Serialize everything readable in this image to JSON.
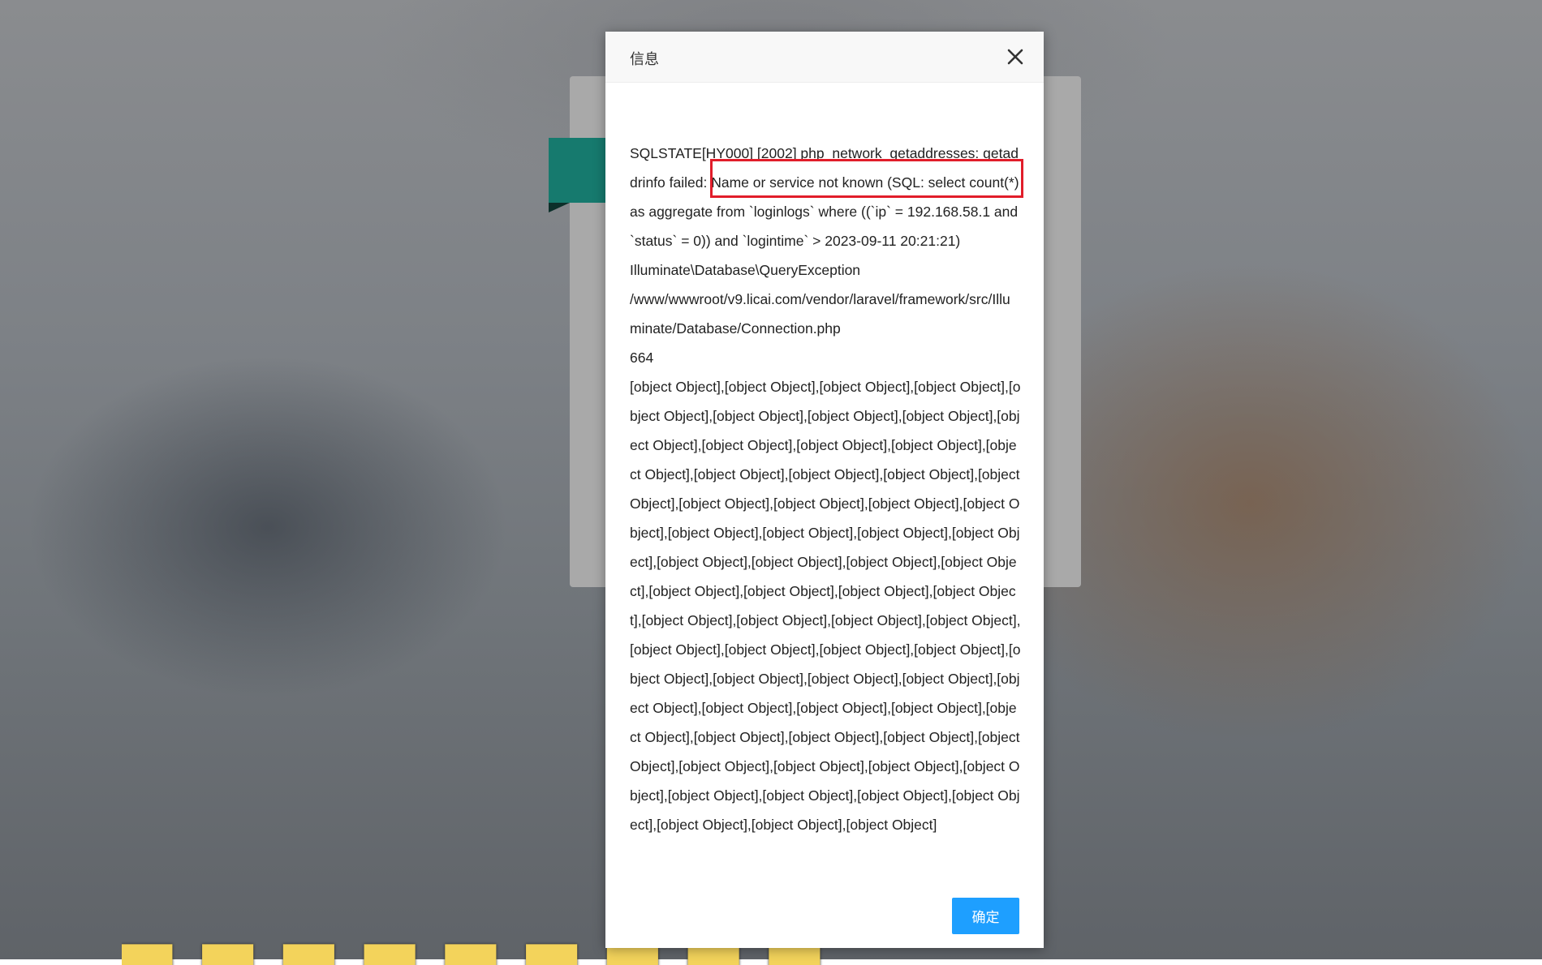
{
  "dialog": {
    "title": "信息",
    "close_icon": "close-icon",
    "confirm_label": "确定",
    "message_lines": [
      "SQLSTATE[HY000] [2002] php_network_getaddresses: getaddrinfo failed: Name or service not known (SQL: select count(*) as aggregate from `loginlogs` where ((`ip` = 192.168.58.1 and `status` = 0)) and `logintime` > 2023-09-11 20:21:21)",
      "Illuminate\\Database\\QueryException",
      "/www/wwwroot/v9.licai.com/vendor/laravel/framework/src/Illuminate/Database/Connection.php",
      "664",
      "[object Object],[object Object],[object Object],[object Object],[object Object],[object Object],[object Object],[object Object],[object Object],[object Object],[object Object],[object Object],[object Object],[object Object],[object Object],[object Object],[object Object],[object Object],[object Object],[object Object],[object Object],[object Object],[object Object],[object Object],[object Object],[object Object],[object Object],[object Object],[object Object],[object Object],[object Object],[object Object],[object Object],[object Object],[object Object],[object Object],[object Object],[object Object],[object Object],[object Object],[object Object],[object Object],[object Object],[object Object],[object Object],[object Object],[object Object],[object Object],[object Object],[object Object],[object Object],[object Object],[object Object],[object Object],[object Object],[object Object],[object Object],[object Object],[object Object],[object Object],[object Object],[object Object],[object Object],[object Object],[object Object]"
    ]
  },
  "colors": {
    "accent": "#1e9fff",
    "highlight": "#e11d2a",
    "subtitle": "#f3d35b"
  }
}
